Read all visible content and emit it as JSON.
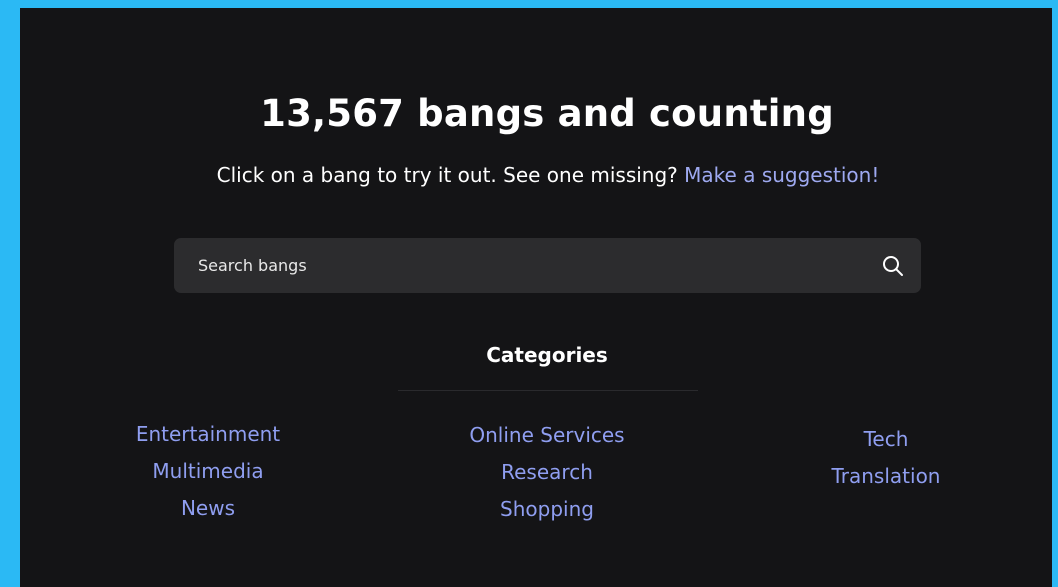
{
  "hero": {
    "headline": "13,567 bangs and counting",
    "subline_text": "Click on a bang to try it out. See one missing? ",
    "suggestion_link": "Make a suggestion!"
  },
  "search": {
    "placeholder": "Search bangs",
    "icon": "search-icon"
  },
  "categories": {
    "title": "Categories",
    "columns": [
      [
        "Entertainment",
        "Multimedia",
        "News"
      ],
      [
        "Online Services",
        "Research",
        "Shopping"
      ],
      [
        "Tech",
        "Translation"
      ]
    ]
  },
  "colors": {
    "frame": "#2bb9f4",
    "background": "#141416",
    "search_box": "#2c2c2e",
    "link": "#9ea9f0"
  }
}
